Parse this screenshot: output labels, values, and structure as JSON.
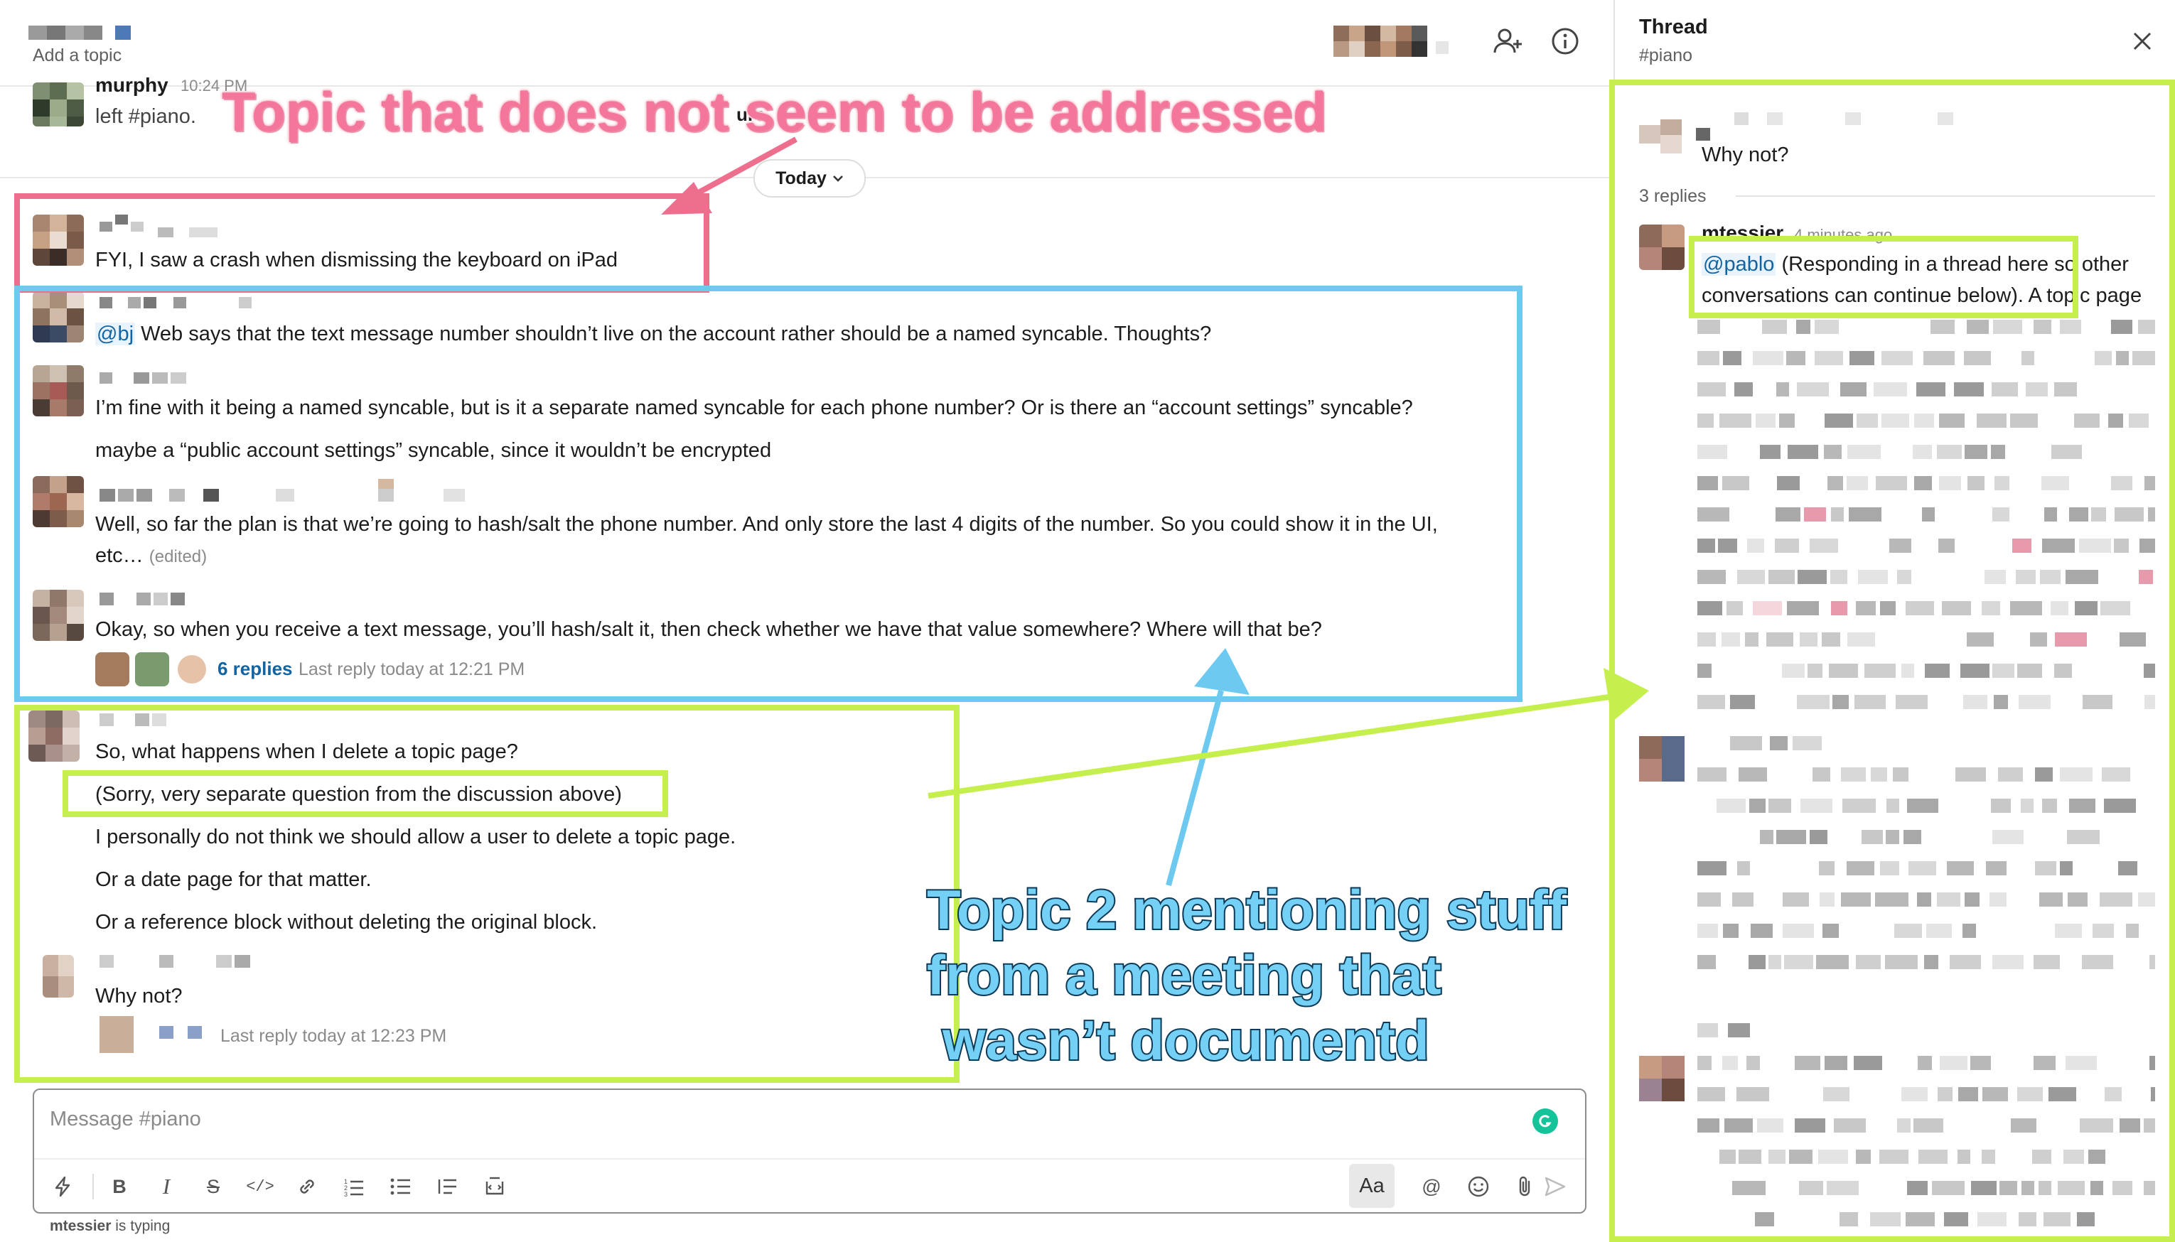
{
  "header": {
    "topic_placeholder": "Add a topic"
  },
  "system_message": {
    "author": "murphy",
    "time": "10:24 PM",
    "text": "left #piano.",
    "partial": "urc"
  },
  "divider": {
    "label": "Today"
  },
  "messages": {
    "m1": {
      "text": "FYI, I saw a crash when dismissing the keyboard on iPad"
    },
    "m2": {
      "mention": "@bj",
      "text": "Web says that the text message number shouldn’t live on the account rather should be a named syncable. Thoughts?"
    },
    "m3": {
      "line1": "I’m fine with it being a named syncable, but is it a separate named syncable for each phone number? Or is there an “account settings” syncable?",
      "line2": "maybe a “public account settings” syncable, since it wouldn’t be encrypted"
    },
    "m4": {
      "line1": "Well, so far the plan is that we’re going to hash/salt the phone number. And only store the last 4 digits of the number. So you could show it in the UI,",
      "line2": "etc…",
      "edited": "(edited)"
    },
    "m5": {
      "text": "Okay, so when you receive a text message, you’ll hash/salt it, then check whether we have that value somewhere? Where will that be?",
      "replies": "6 replies",
      "last_reply": "Last reply today at 12:21 PM"
    },
    "m6": {
      "line1": "So, what happens when I delete a topic page?",
      "line2": "(Sorry, very separate question from the discussion above)",
      "line3": "I personally do not think we should allow a user to delete a topic page.",
      "line4": "Or a date page for that matter.",
      "line5": "Or a reference block without deleting the original block."
    },
    "m7": {
      "text": "Why not?",
      "last_reply": "Last reply today at 12:23 PM"
    }
  },
  "composer": {
    "placeholder": "Message #piano",
    "aa_label": "Aa",
    "typing_user": "mtessier",
    "typing_suffix": "is typing"
  },
  "thread": {
    "title": "Thread",
    "channel": "#piano",
    "parent_text": "Why not?",
    "replies_count": "3 replies",
    "reply_author": "mtessier",
    "reply_time": "4 minutes ago",
    "reply_mention": "@pablo",
    "reply_line1_rest": "(Responding in a thread here so other",
    "reply_line2": "conversations can continue below). A topic page"
  },
  "annotations": {
    "pink": "Topic that does not seem to be addressed",
    "blue_line1": "Topic 2 mentioning stuff",
    "blue_line2": "from a meeting that",
    "blue_line3": "wasn’t documentd"
  },
  "colors": {
    "annotation_pink": "#ee6e8e",
    "annotation_blue": "#6ec9f0",
    "annotation_green": "#c5ef4c",
    "link_blue": "#1264a3"
  },
  "icons": [
    "add-member-icon",
    "info-icon",
    "close-icon",
    "chevron-down-icon",
    "lightning-icon",
    "bold-icon",
    "italic-icon",
    "strikethrough-icon",
    "code-icon",
    "link-icon",
    "numbered-list-icon",
    "bulleted-list-icon",
    "block-quote-icon",
    "code-block-icon",
    "mention-icon",
    "emoji-icon",
    "attach-icon",
    "send-icon",
    "grammarly-icon"
  ]
}
